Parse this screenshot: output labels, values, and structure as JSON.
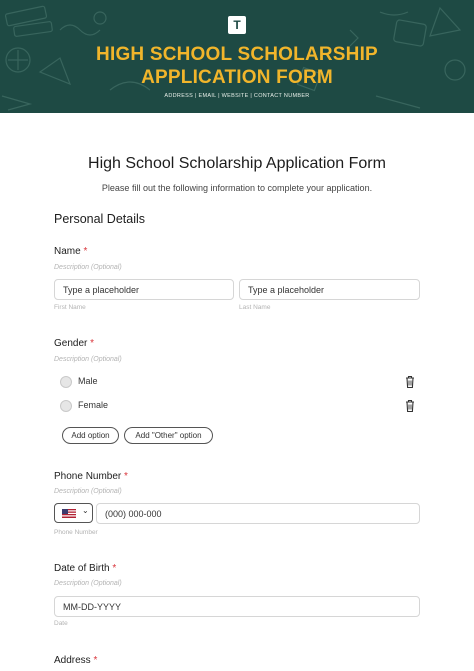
{
  "banner": {
    "logo": "T",
    "title_line1": "HIGH SCHOOL SCHOLARSHIP",
    "title_line2": "APPLICATION FORM",
    "subtitle": "ADDRESS | EMAIL | WEBSITE | CONTACT NUMBER",
    "colors": {
      "background": "#1e4a44",
      "title": "#f1b52b"
    }
  },
  "form": {
    "title": "High School Scholarship Application Form",
    "instructions": "Please fill out the following information to complete your application.",
    "section": "Personal Details",
    "required_mark": "*",
    "description_placeholder": "Description (Optional)"
  },
  "name": {
    "label": "Name",
    "first_placeholder": "Type a placeholder",
    "last_placeholder": "Type a placeholder",
    "first_sublabel": "First Name",
    "last_sublabel": "Last Name"
  },
  "gender": {
    "label": "Gender",
    "options": [
      "Male",
      "Female"
    ],
    "add_option": "Add option",
    "add_other": "Add \"Other\" option"
  },
  "phone": {
    "label": "Phone Number",
    "country_icon": "us-flag-icon",
    "placeholder": "(000) 000-000",
    "sublabel": "Phone Number"
  },
  "dob": {
    "label": "Date of Birth",
    "placeholder": "MM-DD-YYYY",
    "sublabel": "Date"
  },
  "address": {
    "label": "Address"
  }
}
